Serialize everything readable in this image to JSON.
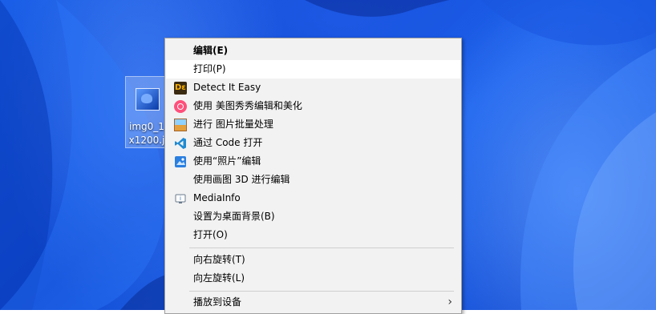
{
  "desktop": {
    "file_icon": {
      "name_line1": "img0_1",
      "name_line2": "x1200.j"
    }
  },
  "context_menu": {
    "items": [
      {
        "label": "编辑(E)",
        "icon": "",
        "bold": true
      },
      {
        "label": "打印(P)",
        "icon": "",
        "hover": true
      },
      {
        "label": "Detect It Easy",
        "icon": "detect-it-easy-icon"
      },
      {
        "label": "使用 美图秀秀编辑和美化",
        "icon": "meitu-icon"
      },
      {
        "label": "进行 图片批量处理",
        "icon": "batch-image-icon"
      },
      {
        "label": "通过 Code 打开",
        "icon": "vscode-icon"
      },
      {
        "label": "使用“照片”编辑",
        "icon": "photos-icon"
      },
      {
        "label": "使用画图 3D 进行编辑",
        "icon": ""
      },
      {
        "label": "MediaInfo",
        "icon": "mediainfo-icon"
      },
      {
        "label": "设置为桌面背景(B)",
        "icon": ""
      },
      {
        "label": "打开(O)",
        "icon": ""
      },
      {
        "label": "向右旋转(T)",
        "icon": ""
      },
      {
        "label": "向左旋转(L)",
        "icon": ""
      },
      {
        "label": "播放到设备",
        "icon": "",
        "submenu": true
      }
    ],
    "submenu_arrow": "›",
    "die_glyph": "Dε"
  }
}
